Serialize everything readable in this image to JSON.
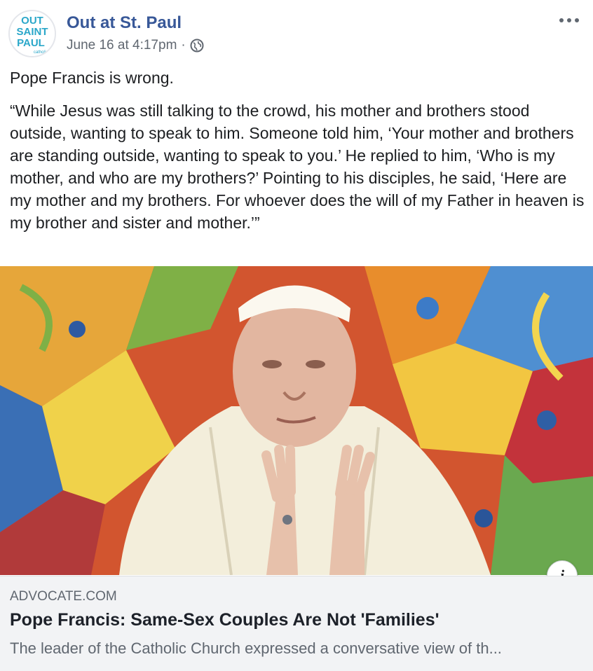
{
  "post": {
    "author": "Out at St. Paul",
    "avatar_text": [
      "OUT",
      "SAINT",
      "PAUL",
      "catholic"
    ],
    "timestamp": "June 16 at 4:17pm",
    "separator": "·",
    "privacy_icon": "globe-icon",
    "more_icon": "more-options-icon",
    "first_line": "Pope Francis is wrong.",
    "quote": "“While Jesus was still talking to the crowd, his mother and brothers stood outside, wanting to speak to him. Someone told him, ‘Your mother and brothers are standing outside, wanting to speak to you.’ He replied to him, ‘Who is my mother, and who are my brothers?’ Pointing to his disciples, he said, ‘Here are my mother and my brothers. For whoever does the will of my Father in heaven is my brother and sister and mother.’”"
  },
  "link_preview": {
    "domain": "ADVOCATE.COM",
    "title": "Pope Francis: Same-Sex Couples Are Not 'Families'",
    "description": "The leader of the Catholic Church expressed a conversative view of th...",
    "info_label": "i",
    "info_icon": "info-icon"
  },
  "colors": {
    "author_link": "#385898",
    "meta_text": "#606770",
    "avatar_brand": "#2aa7c9",
    "link_box_bg": "#f2f3f5"
  }
}
